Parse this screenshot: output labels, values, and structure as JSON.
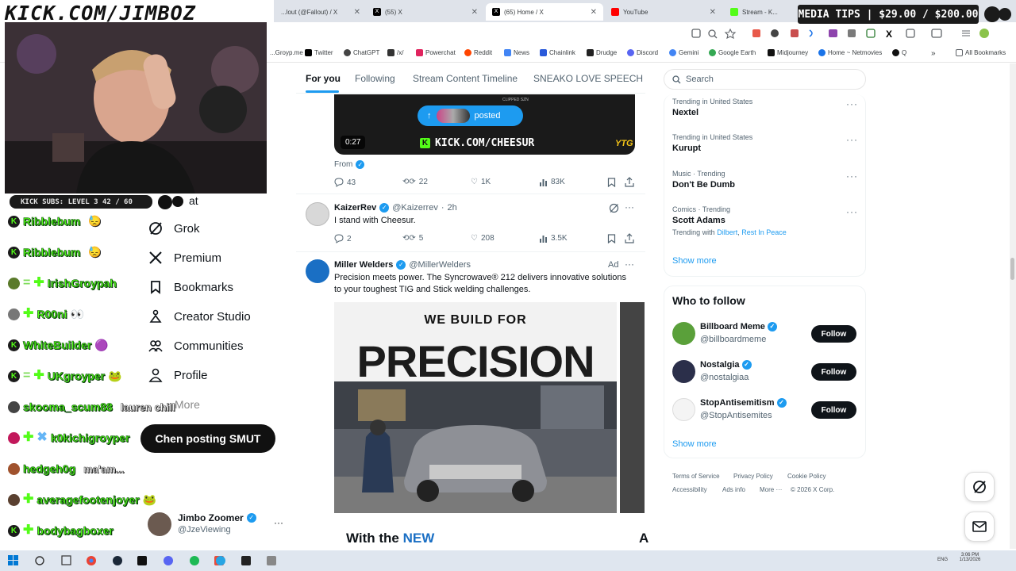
{
  "overlay": {
    "kick_url": "KICK.COM/JIMBOZ",
    "media_tips": "MEDIA TIPS | $29.00 / $200.00",
    "subs_bar": "KICK SUBS: LEVEL 3 42 / 60",
    "chen_message": "Chen posting SMUT"
  },
  "chat": [
    {
      "name": "Ribblebum",
      "msg": "😓"
    },
    {
      "name": "Ribblebum",
      "msg": "😓"
    },
    {
      "name": "IrishGroypah",
      "msg": ""
    },
    {
      "name": "R00ni",
      "msg": ""
    },
    {
      "name": "WhiteBuilder",
      "msg": ""
    },
    {
      "name": "UKgroyper",
      "msg": ""
    },
    {
      "name": "skooma_scum88",
      "msg": "lauren chill"
    },
    {
      "name": "k0kichigroyper",
      "msg": ""
    },
    {
      "name": "hedgeh0g",
      "msg": "ma'am..."
    },
    {
      "name": "averagefootenjoyer",
      "msg": ""
    },
    {
      "name": "bodybagboxer",
      "msg": ""
    }
  ],
  "browser": {
    "tabs": [
      {
        "label": "...lout (@Fallout) / X",
        "color": "#000000"
      },
      {
        "label": "(55) X",
        "color": "#000000"
      },
      {
        "label": "(65) Home / X",
        "color": "#000000"
      },
      {
        "label": "YouTube",
        "color": "#ff0000"
      },
      {
        "label": "Stream - K...",
        "color": "#53fc18"
      }
    ],
    "bookmarks": [
      {
        "label": "...Groyp.me",
        "color": "#888888"
      },
      {
        "label": "Twitter",
        "color": "#000000"
      },
      {
        "label": "ChatGPT",
        "color": "#444444"
      },
      {
        "label": "/x/",
        "color": "#333333"
      },
      {
        "label": "Powerchat",
        "color": "#e0245e"
      },
      {
        "label": "Reddit",
        "color": "#ff4500"
      },
      {
        "label": "News",
        "color": "#4285f4"
      },
      {
        "label": "Chainlink",
        "color": "#2a5ada"
      },
      {
        "label": "Drudge",
        "color": "#222222"
      },
      {
        "label": "Discord",
        "color": "#5865f2"
      },
      {
        "label": "Gemini",
        "color": "#4285f4"
      },
      {
        "label": "Google Earth",
        "color": "#34a853"
      },
      {
        "label": "Midjourney",
        "color": "#111111"
      },
      {
        "label": "Home ~ Netmovies",
        "color": "#1a73e8"
      },
      {
        "label": "Q",
        "color": "#111111"
      }
    ],
    "all_bookmarks": "All Bookmarks"
  },
  "nav": {
    "items": [
      {
        "label": "Grok",
        "icon": "grok-icon"
      },
      {
        "label": "Premium",
        "icon": "x-logo-icon"
      },
      {
        "label": "Bookmarks",
        "icon": "bookmark-icon"
      },
      {
        "label": "Creator Studio",
        "icon": "creator-studio-icon"
      },
      {
        "label": "Communities",
        "icon": "communities-icon"
      },
      {
        "label": "Profile",
        "icon": "profile-icon"
      }
    ],
    "partial_top": "at",
    "partial_bottom": "More",
    "account": {
      "name": "Jimbo Zoomer",
      "handle": "@JzeViewing"
    }
  },
  "feed": {
    "tabs": [
      "For you",
      "Following",
      "Stream Content Timeline",
      "SNEAKO LOVE SPEECH"
    ],
    "video": {
      "posted_label": "posted",
      "duration": "0:27",
      "watermark": "KICK.COM/CHEESUR",
      "corner": "YTG",
      "clipped": "CLIPPED SZN"
    },
    "from_label": "From",
    "post1_stats": {
      "replies": "43",
      "reposts": "22",
      "likes": "1K",
      "views": "83K"
    },
    "post2": {
      "name": "KaizerRev",
      "handle": "@Kaizerrev",
      "time": "2h",
      "text": "I stand with Cheesur.",
      "replies": "2",
      "reposts": "5",
      "likes": "208",
      "views": "3.5K"
    },
    "ad": {
      "name": "Miller Welders",
      "handle": "@MillerWelders",
      "ad_label": "Ad",
      "text": "Precision meets power. The Syncrowave® 212 delivers innovative solutions to your toughest TIG and Stick welding challenges.",
      "card_top": "WE BUILD FOR",
      "card_big": "PRECISION",
      "card_bottom_prefix": "With the",
      "card_bottom_accent": "NEW",
      "card2_letter": "A"
    }
  },
  "sidebar": {
    "search_placeholder": "Search",
    "trends": [
      {
        "context": "Trending in United States",
        "name": "Nextel",
        "with": ""
      },
      {
        "context": "Trending in United States",
        "name": "Kurupt",
        "with": ""
      },
      {
        "context": "Music · Trending",
        "name": "Don't Be Dumb",
        "with": ""
      },
      {
        "context": "Comics · Trending",
        "name": "Scott Adams",
        "with_prefix": "Trending with",
        "with_1": "Dilbert",
        "with_2": "Rest In Peace"
      }
    ],
    "show_more": "Show more",
    "who_to_follow": "Who to follow",
    "follow_suggestions": [
      {
        "name": "Billboard Meme",
        "handle": "@billboardmeme",
        "button": "Follow"
      },
      {
        "name": "Nostalgia",
        "handle": "@nostalgiaa",
        "button": "Follow"
      },
      {
        "name": "StopAntisemitism",
        "handle": "@StopAntisemites",
        "button": "Follow"
      }
    ],
    "show_more_2": "Show more",
    "footer": {
      "tos": "Terms of Service",
      "privacy": "Privacy Policy",
      "cookie": "Cookie Policy",
      "accessibility": "Accessibility",
      "ads": "Ads info",
      "more": "More ···",
      "copyright": "© 2026 X Corp."
    }
  },
  "taskbar": {
    "lang": "ENG",
    "time": "3:06 PM",
    "date": "1/13/2026"
  }
}
